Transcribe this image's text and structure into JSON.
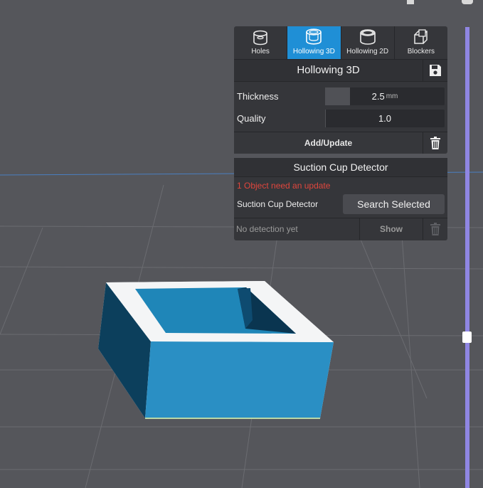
{
  "tabs": [
    {
      "label": "Holes",
      "icon": "holes-icon",
      "active": false
    },
    {
      "label": "Hollowing 3D",
      "icon": "hollowing-3d-icon",
      "active": true
    },
    {
      "label": "Hollowing 2D",
      "icon": "hollowing-2d-icon",
      "active": false
    },
    {
      "label": "Blockers",
      "icon": "blockers-icon",
      "active": false
    }
  ],
  "hollowing": {
    "title": "Hollowing 3D",
    "thickness_label": "Thickness",
    "thickness_value": "2.5",
    "thickness_unit": "mm",
    "thickness_fill": 0.21,
    "quality_label": "Quality",
    "quality_value": "1.0",
    "quality_fill": 0.0,
    "add_update_label": "Add/Update"
  },
  "suction": {
    "title": "Suction Cup Detector",
    "warning": "1 Object need an update",
    "detector_label": "Suction Cup Detector",
    "search_button": "Search Selected",
    "status": "No detection yet",
    "show_button": "Show"
  },
  "layer_slider": {
    "level": 0.66
  },
  "colors": {
    "accent": "#1f8fd6",
    "warning": "#e0463d",
    "model": "#2a8fc4",
    "slider": "#8f86e3",
    "viewport": "#55565b"
  }
}
